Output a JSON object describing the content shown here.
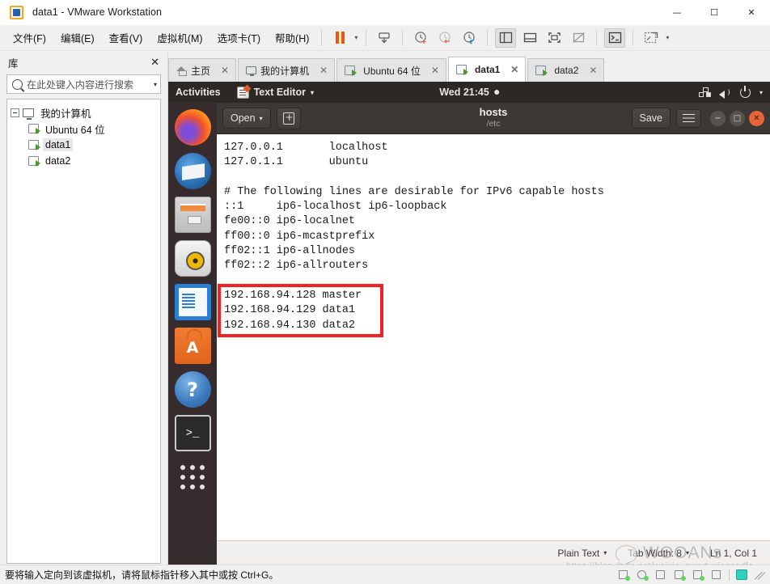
{
  "window": {
    "title": "data1 - VMware Workstation",
    "logo_icon": "vmware-logo-icon",
    "controls": {
      "minimize": "—",
      "maximize": "☐",
      "close": "✕"
    }
  },
  "menubar": {
    "items": [
      {
        "label": "文件(F)"
      },
      {
        "label": "编辑(E)"
      },
      {
        "label": "查看(V)"
      },
      {
        "label": "虚拟机(M)"
      },
      {
        "label": "选项卡(T)"
      },
      {
        "label": "帮助(H)"
      }
    ],
    "toolbar": [
      {
        "name": "pause-vm-button"
      },
      {
        "name": "pause-dropdown-caret"
      },
      {
        "name": "send-ctrl-alt-del-button"
      },
      {
        "name": "snapshot-take-button"
      },
      {
        "name": "snapshot-revert-button"
      },
      {
        "name": "snapshot-manager-button"
      },
      {
        "name": "show-library-button"
      },
      {
        "name": "show-thumbnail-bar-button"
      },
      {
        "name": "enter-fullscreen-button"
      },
      {
        "name": "unity-mode-button"
      },
      {
        "name": "console-view-button"
      },
      {
        "name": "screenshot-button"
      },
      {
        "name": "screenshot-caret"
      }
    ]
  },
  "sidebar": {
    "title": "库",
    "close_label": "✕",
    "search": {
      "placeholder": "在此处键入内容进行搜索",
      "value": ""
    },
    "tree": {
      "root": {
        "label": "我的计算机",
        "icon": "monitor-icon"
      },
      "children": [
        {
          "label": "Ubuntu 64 位",
          "icon": "vm-icon",
          "selected": false
        },
        {
          "label": "data1",
          "icon": "vm-icon",
          "selected": true
        },
        {
          "label": "data2",
          "icon": "vm-icon",
          "selected": false
        }
      ]
    }
  },
  "tabs": [
    {
      "label": "主页",
      "icon": "home-icon",
      "active": false
    },
    {
      "label": "我的计算机",
      "icon": "monitor-icon",
      "active": false
    },
    {
      "label": "Ubuntu 64 位",
      "icon": "vm-icon",
      "active": false
    },
    {
      "label": "data1",
      "icon": "vm-icon",
      "active": true
    },
    {
      "label": "data2",
      "icon": "vm-icon",
      "active": false
    }
  ],
  "guest": {
    "topbar": {
      "activities": "Activities",
      "app_name": "Text Editor",
      "app_caret": "▾",
      "clock": "Wed 21:45",
      "indicators": [
        "network-icon",
        "volume-icon",
        "power-icon",
        "chevron-down-icon"
      ]
    },
    "dock": [
      {
        "name": "firefox",
        "running": false
      },
      {
        "name": "thunderbird",
        "running": false
      },
      {
        "name": "files",
        "running": false
      },
      {
        "name": "rhythmbox",
        "running": false
      },
      {
        "name": "libreoffice-writer",
        "running": false
      },
      {
        "name": "ubuntu-software",
        "running": false
      },
      {
        "name": "help",
        "running": false
      },
      {
        "name": "terminal",
        "running": true
      },
      {
        "name": "show-applications",
        "running": false
      }
    ],
    "editor": {
      "open_label": "Open",
      "open_caret": "▾",
      "new_doc_icon": "new-document-icon",
      "title": "hosts",
      "subtitle": "/etc",
      "save_label": "Save",
      "menu_icon": "hamburger-menu-icon",
      "window_controls": {
        "minimize": "−",
        "maximize": "□",
        "close": "✕"
      },
      "lines": [
        "127.0.0.1       localhost",
        "127.0.1.1       ubuntu",
        "",
        "# The following lines are desirable for IPv6 capable hosts",
        "::1     ip6-localhost ip6-loopback",
        "fe00::0 ip6-localnet",
        "ff00::0 ip6-mcastprefix",
        "ff02::1 ip6-allnodes",
        "ff02::2 ip6-allrouters",
        "",
        "192.168.94.128 master",
        "192.168.94.129 data1",
        "192.168.94.130 data2"
      ],
      "annotation": {
        "color": "#f32121",
        "from_line": 10,
        "to_line": 12
      },
      "statusbar": {
        "language": "Plain Text",
        "language_caret": "▾",
        "tab_width": "Tab Width: 8",
        "tab_width_caret": "▾",
        "position": "Ln 1, Col 1"
      }
    }
  },
  "watermark": {
    "text": "WOOANs",
    "url": "https://blog.csdn.net/weixin_qwertyuiopasdfg"
  },
  "statusbar": {
    "message": "要将输入定向到该虚拟机，请将鼠标指针移入其中或按 Ctrl+G。",
    "icons": [
      "usb-device-icon",
      "cd-drive-icon",
      "floppy-icon",
      "network-adapter-icon",
      "network-adapter2-icon",
      "printer-icon",
      "display-icon"
    ]
  }
}
